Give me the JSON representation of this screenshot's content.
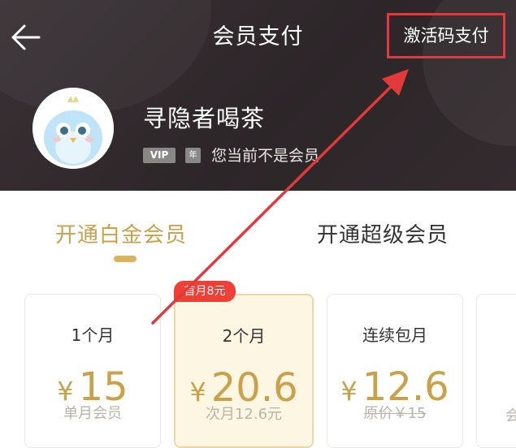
{
  "header": {
    "title": "会员支付",
    "activation_label": "激活码支付",
    "user": {
      "name": "寻隐者喝茶",
      "vip_badge": "VIP",
      "year_badge": "年",
      "status": "您当前不是会员"
    }
  },
  "tabs": [
    {
      "label": "开通白金会员",
      "active": true
    },
    {
      "label": "开通超级会员",
      "active": false
    }
  ],
  "plans": [
    {
      "period": "1个月",
      "currency": "¥",
      "price": "15",
      "note": "单月会员"
    },
    {
      "period": "2个月",
      "currency": "¥",
      "price": "20.6",
      "note": "次月12.6元",
      "promo": "首月8元",
      "selected": true
    },
    {
      "period": "连续包月",
      "currency": "¥",
      "price": "12.6",
      "note": "原价￥15"
    }
  ],
  "partial_card_note": "会",
  "colors": {
    "header_bg": "#2d2629",
    "gold": "#c9a14a",
    "selected_bg": "#fdf6e2",
    "promo_red": "#ef3f36",
    "annotation_red": "#e23a3a"
  }
}
